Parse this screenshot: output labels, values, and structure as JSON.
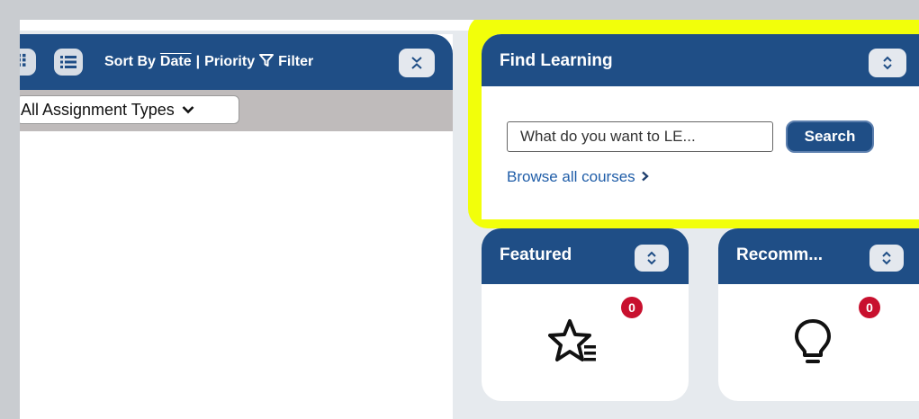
{
  "left_panel": {
    "sort_by_label": "Sort By",
    "sort_date": "Date",
    "separator": "|",
    "sort_priority": "Priority",
    "filter_label": "Filter",
    "assignment_select_value": "All Assignment Types"
  },
  "find_learning": {
    "title": "Find Learning",
    "search_placeholder": "What do you want to LE...",
    "search_button": "Search",
    "browse_link": "Browse all courses"
  },
  "featured": {
    "title": "Featured",
    "badge_count": "0",
    "icon": "star-list-icon"
  },
  "recommended": {
    "title": "Recomm...",
    "badge_count": "0",
    "icon": "lightbulb-icon"
  },
  "colors": {
    "header_blue": "#1f4e86",
    "highlight_yellow": "#f2ff0a",
    "badge_red": "#c8102e",
    "link_blue": "#1f5da8"
  }
}
